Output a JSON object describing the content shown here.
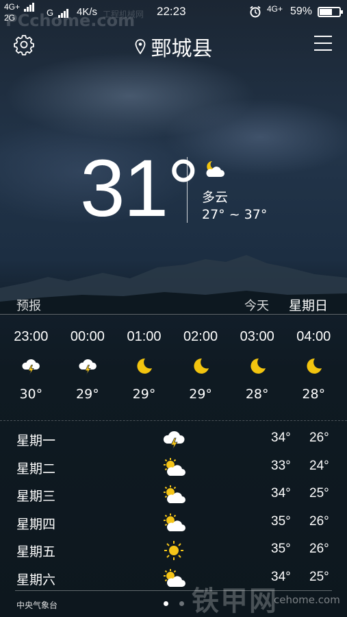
{
  "status_bar": {
    "signal_1": "4G+",
    "signal_2": "2G",
    "network_g": "G",
    "speed": "4K/s",
    "time": "22:23",
    "network_4g": "4G+",
    "battery_pct": "59%",
    "battery_level": 0.59
  },
  "header": {
    "city": "鄄城县",
    "left_icon": "gear-icon",
    "right_icon": "menu-icon"
  },
  "current": {
    "temp": "31°",
    "condition": "多云",
    "range": "27° ~ 37°",
    "icon": "partly-cloudy-night-icon"
  },
  "forecast": {
    "label": "预报",
    "today": "今天",
    "weekday": "星期日"
  },
  "hourly": [
    {
      "time": "23:00",
      "icon": "thunder-cloud-icon",
      "temp": "30°"
    },
    {
      "time": "00:00",
      "icon": "thunder-cloud-icon",
      "temp": "29°"
    },
    {
      "time": "01:00",
      "icon": "moon-icon",
      "temp": "29°"
    },
    {
      "time": "02:00",
      "icon": "moon-icon",
      "temp": "29°"
    },
    {
      "time": "03:00",
      "icon": "moon-icon",
      "temp": "28°"
    },
    {
      "time": "04:00",
      "icon": "moon-icon",
      "temp": "28°"
    }
  ],
  "daily": [
    {
      "day": "星期一",
      "icon": "thunder-cloud-icon",
      "high": "34°",
      "low": "26°"
    },
    {
      "day": "星期二",
      "icon": "partly-cloudy-icon",
      "high": "33°",
      "low": "24°"
    },
    {
      "day": "星期三",
      "icon": "partly-cloudy-icon",
      "high": "34°",
      "low": "25°"
    },
    {
      "day": "星期四",
      "icon": "partly-cloudy-icon",
      "high": "35°",
      "low": "26°"
    },
    {
      "day": "星期五",
      "icon": "sun-icon",
      "high": "35°",
      "low": "26°"
    },
    {
      "day": "星期六",
      "icon": "partly-cloudy-icon",
      "high": "34°",
      "low": "25°"
    }
  ],
  "footer": {
    "source": "中央气象台",
    "page_count": 2,
    "active_page": 1
  },
  "watermarks": {
    "top": "PCchome.com",
    "top_small": "工程机械网",
    "bottom": "铁甲网",
    "bottom_small": "cehome.com"
  },
  "colors": {
    "sun": "#f5c518",
    "moon": "#f2c40f",
    "cloud": "#ffffff"
  }
}
